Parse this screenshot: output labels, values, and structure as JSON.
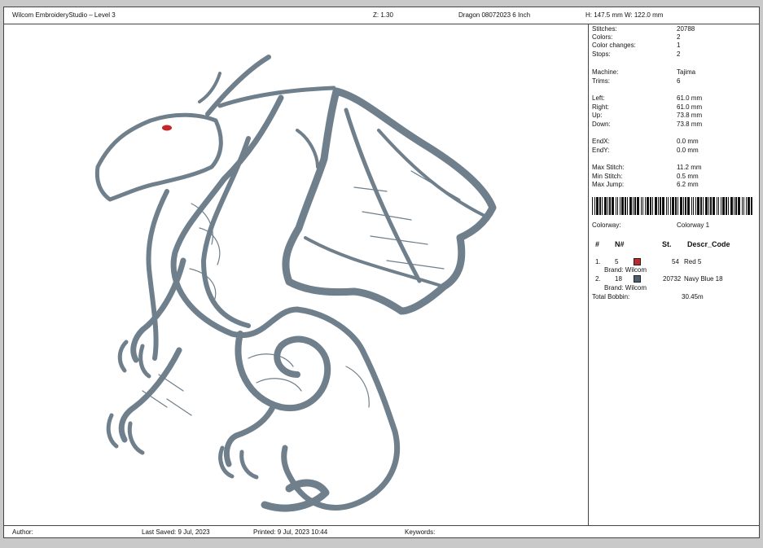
{
  "header": {
    "app_title": "Wilcom EmbroideryStudio – Level 3",
    "zoom": "Z: 1.30",
    "design_name": "Dragon 08072023 6 Inch",
    "height": "H: 147.5 mm",
    "width": "W: 122.0 mm"
  },
  "stats": [
    {
      "label": "Stitches:",
      "value": "20788"
    },
    {
      "label": "Colors:",
      "value": "2"
    },
    {
      "label": "Color changes:",
      "value": "1"
    },
    {
      "label": "Stops:",
      "value": "2"
    },
    {
      "label": "Machine:",
      "value": "Tajima"
    },
    {
      "label": "Trims:",
      "value": "6"
    },
    {
      "label": "Left:",
      "value": "61.0 mm"
    },
    {
      "label": "Right:",
      "value": "61.0 mm"
    },
    {
      "label": "Up:",
      "value": "73.8 mm"
    },
    {
      "label": "Down:",
      "value": "73.8 mm"
    },
    {
      "label": "EndX:",
      "value": "0.0 mm"
    },
    {
      "label": "EndY:",
      "value": "0.0 mm"
    },
    {
      "label": "Max Stitch:",
      "value": "11.2 mm"
    },
    {
      "label": "Min Stitch:",
      "value": "0.5 mm"
    },
    {
      "label": "Max Jump:",
      "value": "6.2 mm"
    }
  ],
  "colorway": {
    "label": "Colorway:",
    "value": "Colorway 1"
  },
  "table": {
    "headers": {
      "num": "#",
      "n": "N#",
      "st": "St.",
      "descr": "Descr",
      "code": "_Code"
    },
    "rows": [
      {
        "index": "1.",
        "n": "5",
        "color": "#c0282a",
        "st": "54",
        "descr": "Red 5",
        "brand": "Brand: Wilcom"
      },
      {
        "index": "2.",
        "n": "18",
        "color": "#4e5f6d",
        "st": "20732",
        "descr": "Navy Blue 18",
        "brand": "Brand: Wilcom"
      }
    ],
    "total_label": "Total Bobbin:",
    "total_value": "30.45m"
  },
  "footer": {
    "author": "Author:",
    "last_saved": "Last Saved:  9 Jul, 2023",
    "printed": "Printed:  9 Jul, 2023 10:44",
    "keywords": "Keywords:"
  },
  "thread_color": "#6f7f8b",
  "eye_color": "#c0282a"
}
